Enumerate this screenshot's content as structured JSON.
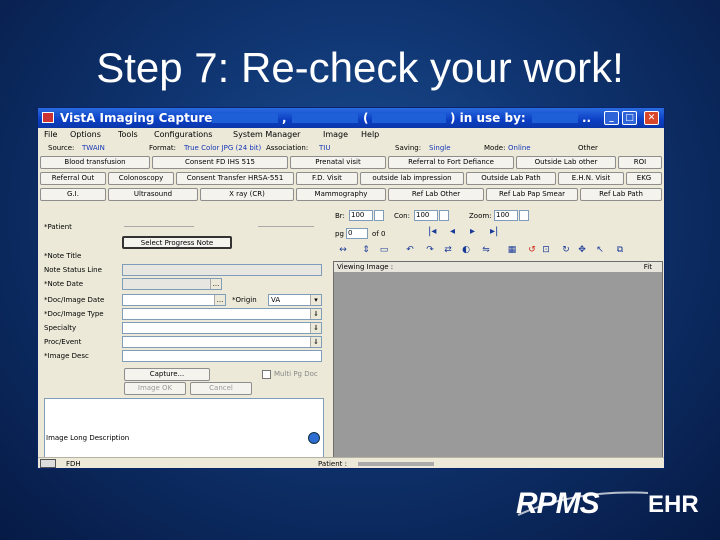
{
  "slide": {
    "title": "Step 7:  Re-check your work!"
  },
  "window": {
    "title_prefix": "VistA Imaging Capture :",
    "title_sep_comma": ",",
    "title_paren_open": "(",
    "title_paren_close": ")  in use by:",
    "title_suffix": "..",
    "btn_minimize": "_",
    "btn_maximize": "□",
    "btn_close": "✕"
  },
  "menu": [
    "File",
    "Options",
    "Tools",
    "Configurations",
    "System Manager",
    "Image",
    "Help"
  ],
  "info_row": {
    "source_label": "Source:",
    "source_value": "TWAIN",
    "format_label": "Format:",
    "format_value": "True Color JPG (24 bit)",
    "association_label": "Association:",
    "association_value": "TIU",
    "saving_label": "Saving:",
    "saving_value": "Single",
    "mode_label": "Mode:",
    "mode_value": "Online",
    "other_label": "Other"
  },
  "button_rows": [
    [
      "Blood transfusion",
      "Consent FD IHS 515",
      "Prenatal visit",
      "Referral to Fort Defiance",
      "Outside Lab other",
      "ROI"
    ],
    [
      "Referral Out",
      "Colonoscopy",
      "Consent Transfer HRSA-551",
      "F.D. Visit",
      "outside lab impression",
      "Outside Lab Path",
      "E.H.N. Visit",
      "EKG"
    ],
    [
      "G.I.",
      "Ultrasound",
      "X ray (CR)",
      "Mammography",
      "Ref Lab Other",
      "Ref Lab Pap Smear",
      "Ref Lab Path"
    ]
  ],
  "form": {
    "patient_label": "*Patient",
    "note_title_label": "*Note Title",
    "select_progress_note": "Select Progress Note",
    "note_status_label": "Note Status Line",
    "note_date_label": "*Note Date",
    "doc_date_label": "*Doc/Image Date",
    "origin_label": "*Origin",
    "origin_value": "VA",
    "doc_type_label": "*Doc/Image Type",
    "specialty_label": "Specialty",
    "proc_event_label": "Proc/Event",
    "image_desc_label": "*Image Desc",
    "ellipsis": "...",
    "capture_btn": "Capture...",
    "multi_pg_label": "Multi Pg Doc",
    "image_ok_btn": "Image OK",
    "cancel_btn": "Cancel",
    "long_desc_label": "Image Long Description"
  },
  "viewer": {
    "br_label": "Br:",
    "br_value": "100",
    "con_label": "Con:",
    "con_value": "100",
    "zoom_label": "Zoom:",
    "zoom_value": "100",
    "pg_label": "pg",
    "pg_value": "0",
    "of_label": "of 0",
    "header": "Viewing Image :",
    "fit": "Fit"
  },
  "statusbar": {
    "left": "FDH",
    "patient_label": "Patient :"
  },
  "logo": {
    "rpms": "RPMS",
    "ehr": "EHR"
  },
  "colors": {
    "title_bar": "#0b3fc4",
    "blue_text": "#1638b8",
    "background": "#0f3470"
  }
}
